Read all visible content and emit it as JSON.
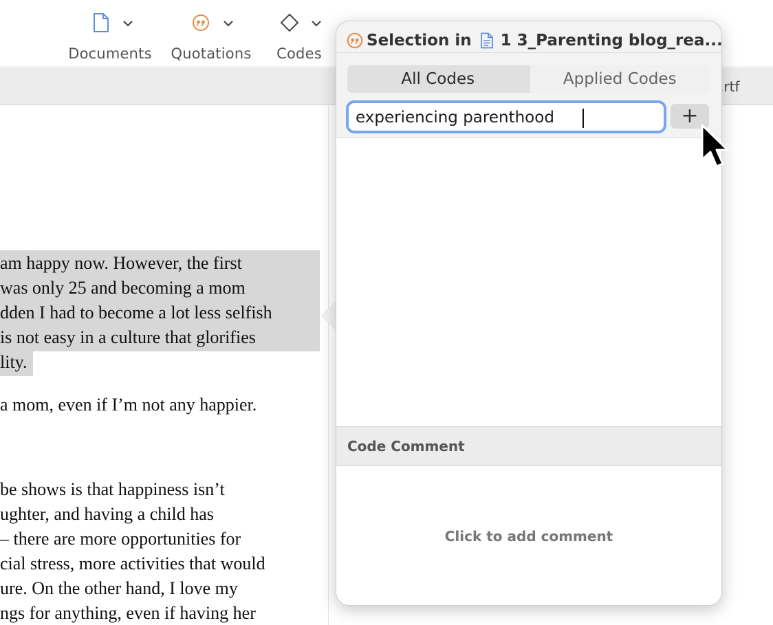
{
  "toolbar": {
    "documents_label": "Documents",
    "quotations_label": "Quotations",
    "codes_label": "Codes"
  },
  "tab": {
    "title_tail": ".rtf"
  },
  "document": {
    "selected_lines": [
      " am happy now. However, the first",
      "was only 25 and becoming a mom",
      "dden I had to become a lot less selfish",
      " is not easy in a culture that glorifies",
      "lity."
    ],
    "line_after": "a mom, even if I’m not any happier.",
    "paragraph_2": [
      "be shows is that happiness isn’t",
      "ughter, and having a child has",
      "– there are more opportunities for",
      "cial stress, more activities that would",
      "ure. On the other hand, I love my",
      "ngs for anything, even if having her"
    ]
  },
  "popover": {
    "title_prefix": "Selection in",
    "document_name": "1 3_Parenting blog_rea...",
    "tabs": [
      {
        "label": "All Codes",
        "active": true
      },
      {
        "label": "Applied Codes",
        "active": false
      }
    ],
    "search": {
      "value": "experiencing parenthood",
      "placeholder": ""
    },
    "add_label": "+",
    "comment_header": "Code Comment",
    "comment_placeholder": "Click to add comment"
  },
  "colors": {
    "accent_focus": "#7aa6ec",
    "quotation_orange": "#ea8a45",
    "document_blue": "#5b8ee0",
    "selection_gray": "#d7d7d7"
  },
  "icons": {
    "documents": "document-icon",
    "quotations": "quotation-icon",
    "codes": "diamond-icon",
    "cursor": "arrow-cursor-icon"
  }
}
